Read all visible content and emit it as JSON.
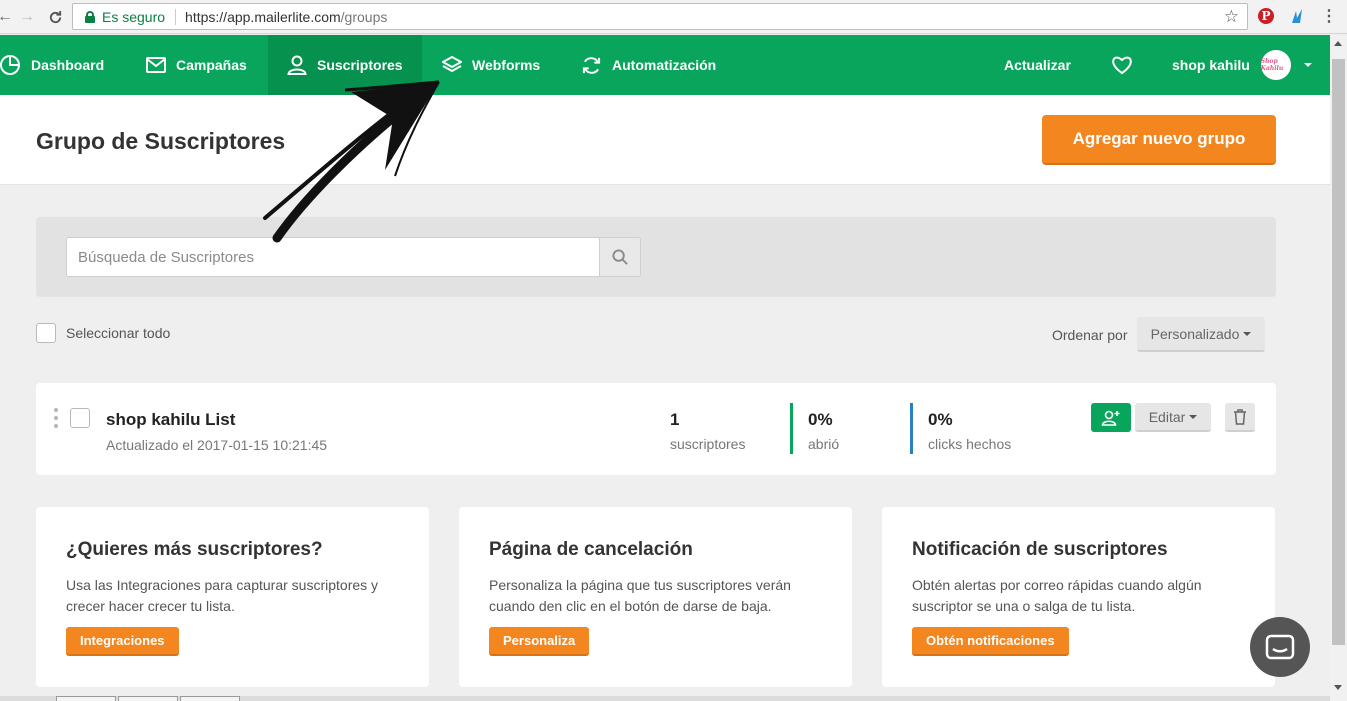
{
  "browser": {
    "secure_label": "Es seguro",
    "url_main": "https://app.mailerlite.com",
    "url_path": "/groups",
    "extension_pinterest": "P"
  },
  "nav": {
    "items": [
      {
        "label": "Dashboard",
        "icon": "pie-chart-icon"
      },
      {
        "label": "Campañas",
        "icon": "envelope-icon"
      },
      {
        "label": "Suscriptores",
        "icon": "user-icon",
        "active": true
      },
      {
        "label": "Webforms",
        "icon": "layers-icon"
      },
      {
        "label": "Automatización",
        "icon": "refresh-icon"
      }
    ],
    "update_label": "Actualizar",
    "favorites_icon": "heart-icon",
    "account_name": "shop kahilu",
    "avatar_text": "Shop Kahilu"
  },
  "header": {
    "title": "Grupo de Suscriptores",
    "add_group_label": "Agregar nuevo grupo"
  },
  "search": {
    "placeholder": "Búsqueda de Suscriptores",
    "value": ""
  },
  "list_controls": {
    "select_all_label": "Seleccionar todo",
    "order_by_label": "Ordenar por",
    "order_value": "Personalizado"
  },
  "groups": [
    {
      "name": "shop kahilu List",
      "updated": "Actualizado el 2017-01-15 10:21:45",
      "subscribers_value": "1",
      "subscribers_label": "suscriptores",
      "opened_value": "0%",
      "opened_label": "abrió",
      "clicks_value": "0%",
      "clicks_label": "clicks hechos",
      "edit_label": "Editar"
    }
  ],
  "info_cards": [
    {
      "title": "¿Quieres más suscriptores?",
      "text": "Usa las Integraciones para capturar suscriptores y crecer hacer crecer tu lista.",
      "button": "Integraciones"
    },
    {
      "title": "Página de cancelación",
      "text": "Personaliza la página que tus suscriptores verán cuando den clic en el botón de darse de baja.",
      "button": "Personaliza"
    },
    {
      "title": "Notificación de suscriptores",
      "text": "Obtén alertas por correo rápidas cuando algún suscriptor se una o salga de tu lista.",
      "button": "Obtén notificaciones"
    }
  ],
  "colors": {
    "brand_green": "#09a55c",
    "accent_orange": "#f4861f",
    "stat_opened": "#09a55c",
    "stat_clicks": "#2a7fc0"
  }
}
